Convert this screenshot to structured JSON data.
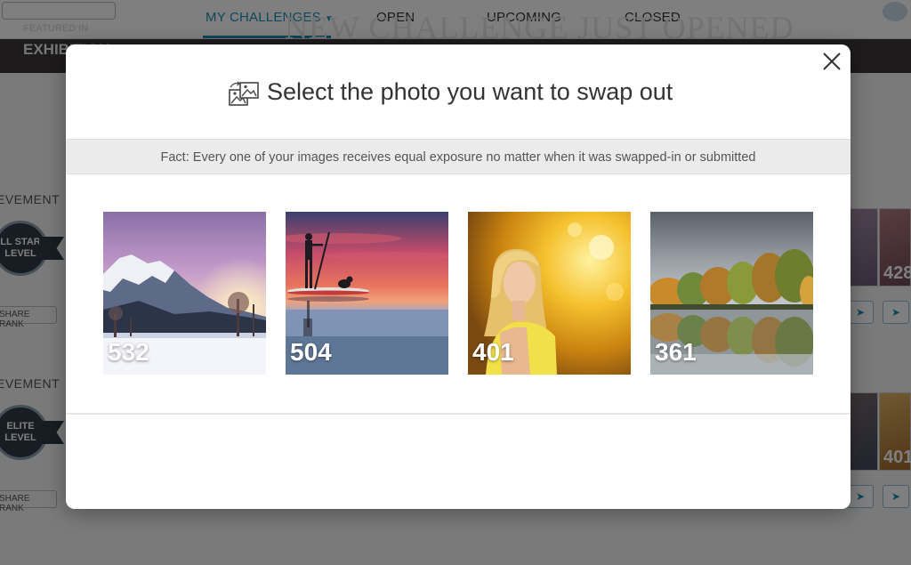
{
  "background": {
    "nav_tabs": [
      {
        "label": "MY CHALLENGES",
        "active": true
      },
      {
        "label": "OPEN",
        "active": false
      },
      {
        "label": "UPCOMING",
        "active": false
      },
      {
        "label": "CLOSED",
        "active": false
      }
    ],
    "banner": {
      "featured_label": "FEATURED IN",
      "exhibition_label": "EXHIBITION",
      "headline": "NEW CHALLENGE JUST OPENED"
    },
    "sections": [
      {
        "label": "EVEMENT",
        "level_text_1": "LL STAR",
        "level_text_2": "LEVEL",
        "share_rank": "SHARE RANK",
        "thumb_count": "428"
      },
      {
        "label": "EVEMENT",
        "level_text_1": "ELITE",
        "level_text_2": "LEVEL",
        "share_rank": "SHARE RANK",
        "thumb_count": "401"
      }
    ]
  },
  "modal": {
    "title": "Select the photo you want to swap out",
    "fact": "Fact: Every one of your images receives equal exposure no matter when it was swapped-in or submitted",
    "close_icon": "close-icon",
    "title_icon": "swap-photo-icon",
    "photos": [
      {
        "count": "532",
        "subject": "snowy mountain at purple sunset"
      },
      {
        "count": "504",
        "subject": "paddleboarder with dog at sunset"
      },
      {
        "count": "401",
        "subject": "blonde woman in yellow dress"
      },
      {
        "count": "361",
        "subject": "autumn trees reflected in lake"
      }
    ]
  },
  "colors": {
    "accent": "#1a8fb3",
    "overlay": "rgba(0,0,0,0.5)",
    "fact_bar": "#ebebeb"
  }
}
